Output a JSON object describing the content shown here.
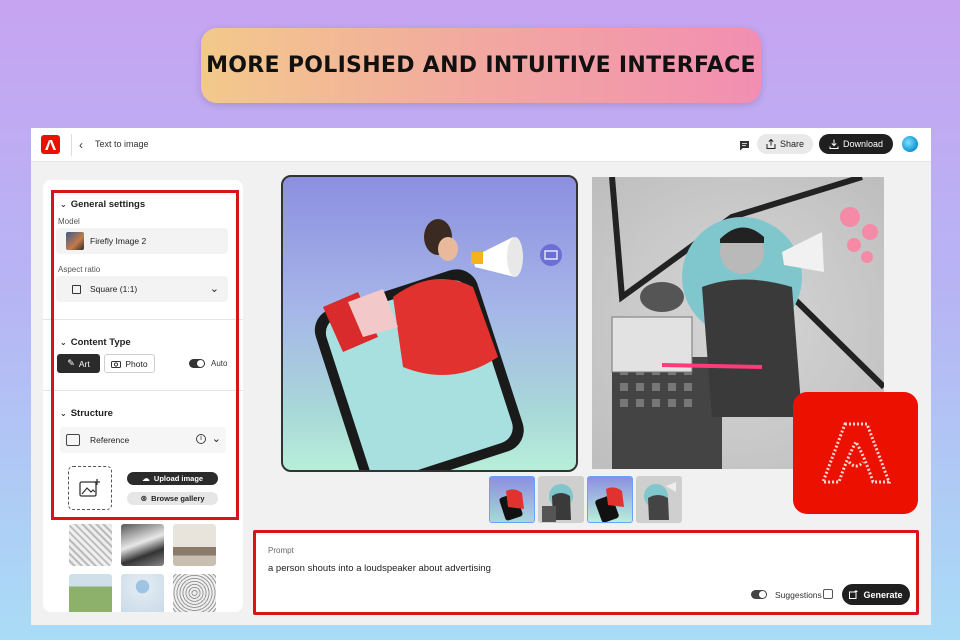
{
  "banner": {
    "text": "MORE POLISHED AND INTUITIVE INTERFACE"
  },
  "topbar": {
    "breadcrumb": "Text to image",
    "share_label": "Share",
    "download_label": "Download"
  },
  "panel": {
    "general": {
      "title": "General settings",
      "model_label": "Model",
      "model_value": "Firefly Image 2",
      "aspect_label": "Aspect ratio",
      "aspect_value": "Square (1:1)"
    },
    "content_type": {
      "title": "Content Type",
      "art_label": "Art",
      "photo_label": "Photo",
      "auto_label": "Auto"
    },
    "structure": {
      "title": "Structure",
      "reference_label": "Reference",
      "upload_label": "Upload image",
      "browse_label": "Browse gallery"
    }
  },
  "prompt": {
    "label": "Prompt",
    "value": "a person shouts into a loudspeaker about advertising",
    "suggestions_label": "Suggestions",
    "generate_label": "Generate"
  },
  "colors": {
    "accent": "#eb1000",
    "highlight": "#d7141a",
    "dark": "#1f1f1f"
  }
}
